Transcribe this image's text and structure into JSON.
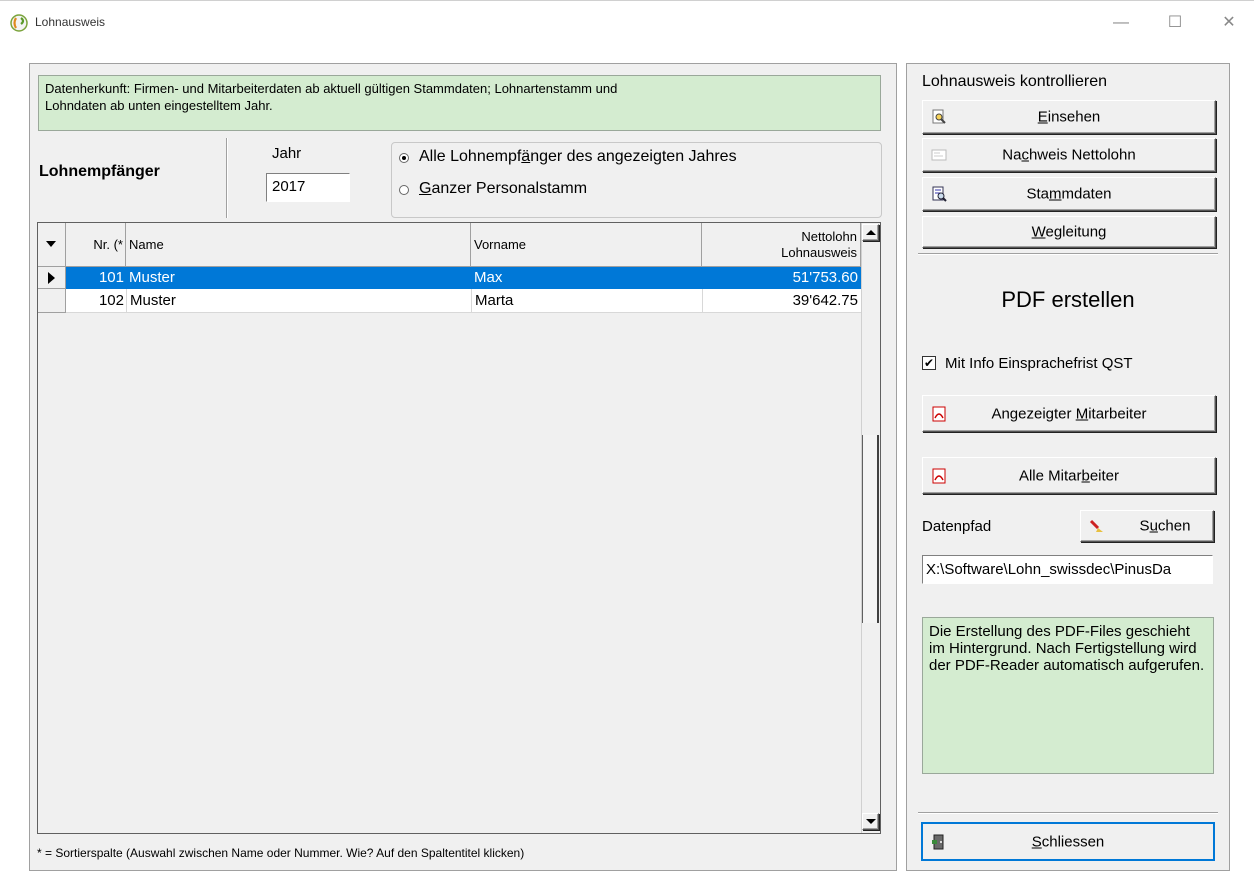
{
  "window": {
    "title": "Lohnausweis",
    "min_glyph": "—",
    "max_glyph": "☐",
    "close_glyph": "✕"
  },
  "info": {
    "line1": "Datenherkunft: Firmen- und Mitarbeiterdaten ab aktuell gültigen Stammdaten; Lohnartenstamm und",
    "line2": "Lohndaten ab unten eingestelltem Jahr."
  },
  "filter": {
    "section_label": "Lohnempfänger",
    "year_label": "Jahr",
    "year_value": "2017",
    "option_all": {
      "pre": "Alle Lohnempf",
      "u": "ä",
      "post": "nger des angezeigten Jahres",
      "selected": true
    },
    "option_staff": {
      "pre": "",
      "u": "G",
      "post": "anzer Personalstamm",
      "selected": false
    }
  },
  "grid": {
    "columns": {
      "nr": "Nr. (*",
      "name": "Name",
      "vorname": "Vorname",
      "netto_line1": "Nettolohn",
      "netto_line2": "Lohnausweis"
    },
    "rows": [
      {
        "nr": "101",
        "name": "Muster",
        "vorname": "Max",
        "netto": "51'753.60",
        "selected": true
      },
      {
        "nr": "102",
        "name": "Muster",
        "vorname": "Marta",
        "netto": "39'642.75",
        "selected": false
      }
    ]
  },
  "footnote": "* = Sortierspalte (Auswahl zwischen Name oder Nummer. Wie? Auf den Spaltentitel klicken)",
  "side": {
    "control_title": "Lohnausweis kontrollieren",
    "btn_einsehen": {
      "pre": "",
      "u": "E",
      "post": "insehen"
    },
    "btn_nachweis": {
      "pre": "Na",
      "u": "c",
      "post": "hweis Nettolohn"
    },
    "btn_stammdaten": {
      "pre": "Sta",
      "u": "m",
      "post": "mdaten"
    },
    "btn_wegleitung": {
      "pre": "",
      "u": "W",
      "post": "egleitung"
    },
    "pdf_title": "PDF erstellen",
    "qst_label": "Mit Info Einsprachefrist QST",
    "qst_checked": true,
    "btn_angezeigt": {
      "pre": "Angezeigter ",
      "u": "M",
      "post": "itarbeiter"
    },
    "btn_alle": {
      "pre": "Alle Mitar",
      "u": "b",
      "post": "eiter"
    },
    "datenpfad_label": "Datenpfad",
    "btn_suchen": {
      "pre": "S",
      "u": "u",
      "post": "chen"
    },
    "path_value": "X:\\Software\\Lohn_swissdec\\PinusDa",
    "pdf_info": "Die Erstellung des PDF-Files geschieht im Hintergrund. Nach Fertigstellung wird der PDF-Reader automatisch aufgerufen.",
    "btn_schliessen": {
      "pre": "",
      "u": "S",
      "post": "chliessen"
    }
  },
  "colors": {
    "selection": "#0078d7",
    "info_green": "#d4ecd0",
    "panel_gray": "#f0f0f0"
  }
}
